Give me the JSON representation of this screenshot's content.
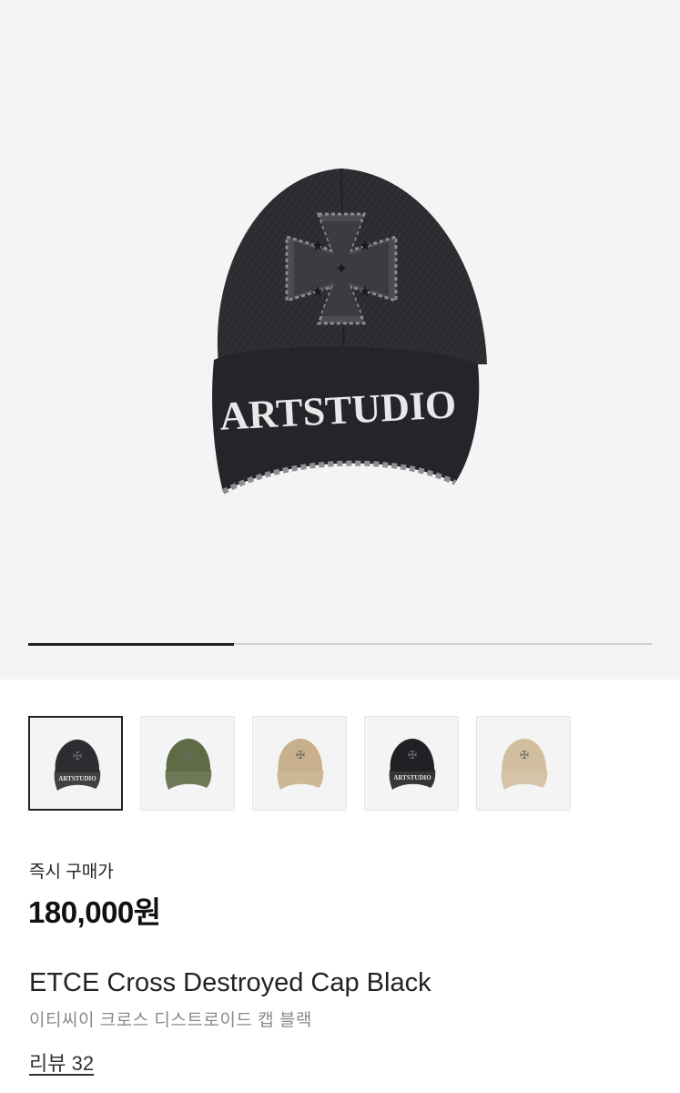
{
  "product": {
    "image_alt": "ETCE Cross Destroyed Cap Black",
    "cap_print": "ARTSTUDIO",
    "gallery_progress": 0.33,
    "price_label": "즉시 구매가",
    "price": "180,000원",
    "name_en": "ETCE Cross Destroyed Cap Black",
    "name_ko": "이티씨이 크로스 디스트로이드 캡 블랙",
    "review_link": "리뷰 32"
  },
  "thumbnails": [
    {
      "color": "#2b2d30",
      "selected": true,
      "print": "ARTSTUDIO"
    },
    {
      "color": "#5e6b45",
      "selected": false,
      "print": ""
    },
    {
      "color": "#c9b08c",
      "selected": false,
      "print": ""
    },
    {
      "color": "#1f2124",
      "selected": false,
      "print": "ARTSTUDIO"
    },
    {
      "color": "#d2bf9f",
      "selected": false,
      "print": ""
    }
  ],
  "colors": {
    "accent": "#222222",
    "track": "#cfcfcf",
    "muted": "#8a8a8a"
  }
}
